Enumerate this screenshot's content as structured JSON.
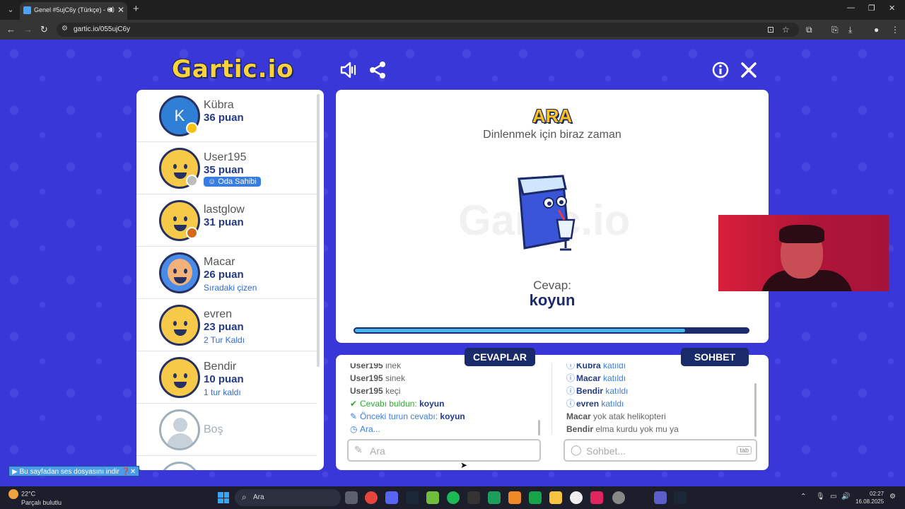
{
  "browser": {
    "tab_title": "Genel #5ujC6y (Türkçe) - G",
    "url": "gartic.io/055ujC6y"
  },
  "logo_text": "Gartic.io",
  "players": [
    {
      "name": "Kübra",
      "score": "36 puan",
      "note": "",
      "initial": "K",
      "status_color": "#f7c20e"
    },
    {
      "name": "User195",
      "score": "35 puan",
      "badge": "Oda Sahibi",
      "note": "",
      "status_color": "#bdbdbd"
    },
    {
      "name": "lastglow",
      "score": "31 puan",
      "note": "",
      "status_color": "#d36a15"
    },
    {
      "name": "Macar",
      "score": "26 puan",
      "note": "Sıradaki çizen"
    },
    {
      "name": "evren",
      "score": "23 puan",
      "note": "2 Tur Kaldı"
    },
    {
      "name": "Bendir",
      "score": "10 puan",
      "note": "1 tur kaldı"
    },
    {
      "name": "Boş"
    }
  ],
  "canvas": {
    "title": "ARA",
    "subtitle": "Dinlenmek için biraz zaman",
    "answer_label": "Cevap:",
    "answer": "koyun",
    "progress": 0.84
  },
  "answers_tab": "CEVAPLAR",
  "chat_tab": "SOHBET",
  "answers_log": [
    {
      "user": "User195",
      "text": "inek"
    },
    {
      "user": "User195",
      "text": "sinek"
    },
    {
      "user": "User195",
      "text": "keçi"
    }
  ],
  "answers_found": {
    "text": "Cevabı buldun:",
    "word": "koyun"
  },
  "answers_prev": {
    "text": "Önceki turun cevabı:",
    "word": "koyun"
  },
  "answers_status": "Ara...",
  "answers_placeholder": "Ara",
  "chat_joins": [
    {
      "user": "Kübra",
      "text": "katıldı"
    },
    {
      "user": "Macar",
      "text": "katıldı"
    },
    {
      "user": "Bendir",
      "text": "katıldı"
    },
    {
      "user": "evren",
      "text": "katıldı"
    }
  ],
  "chat_messages": [
    {
      "user": "Macar",
      "text": "yok atak helikopteri"
    },
    {
      "user": "Bendir",
      "text": "elma kurdu yok mu ya"
    }
  ],
  "chat_placeholder": "Sohbet...",
  "chat_key_hint": "tab",
  "download_bar": "Bu sayfadan ses dosyasını indir",
  "taskbar": {
    "temperature": "22°C",
    "weather": "Parçalı bulutlu",
    "search_placeholder": "Ara",
    "time": "02:27",
    "date": "16.08.2025"
  }
}
